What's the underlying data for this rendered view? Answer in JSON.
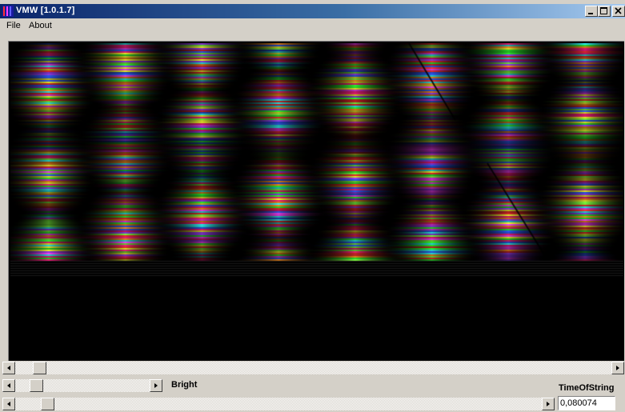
{
  "window": {
    "title": "VMW [1.0.1.7]",
    "title_bar_colors": [
      "#0a246a",
      "#a6caf0"
    ]
  },
  "menu": {
    "items": [
      {
        "label": "File"
      },
      {
        "label": "About"
      }
    ]
  },
  "controls": {
    "bright_label": "Bright",
    "time_label": "TimeOfString",
    "time_value": "0,080074",
    "main_scroll_position": 0.03,
    "bright_scroll_position": 0.12,
    "time_scroll_position": 0.05
  },
  "icons": {
    "app": "app-icon",
    "minimize": "minimize-icon",
    "maximize": "maximize-icon",
    "close": "close-icon",
    "scroll_left": "arrow-left-icon",
    "scroll_right": "arrow-right-icon"
  }
}
